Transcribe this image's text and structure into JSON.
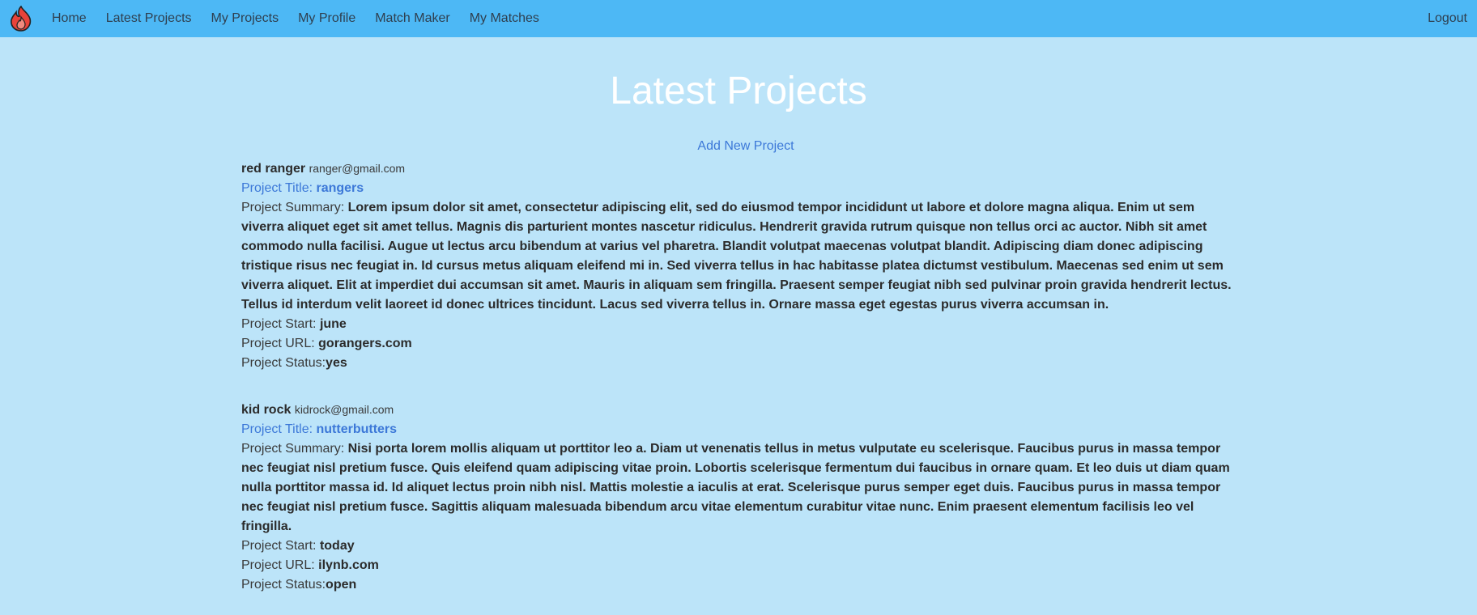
{
  "nav": {
    "links": [
      {
        "label": "Home"
      },
      {
        "label": "Latest Projects"
      },
      {
        "label": "My Projects"
      },
      {
        "label": "My Profile"
      },
      {
        "label": "Match Maker"
      },
      {
        "label": "My Matches"
      }
    ],
    "logout_label": "Logout",
    "logo_icon": "flame-icon"
  },
  "page": {
    "title": "Latest Projects",
    "add_project_label": "Add New Project"
  },
  "labels": {
    "project_title": "Project Title:",
    "project_summary": "Project Summary:",
    "project_start": "Project Start:",
    "project_url": "Project URL:",
    "project_status": "Project Status:"
  },
  "projects": [
    {
      "owner_name": "red ranger",
      "owner_email": "ranger@gmail.com",
      "title": "rangers",
      "summary": "Lorem ipsum dolor sit amet, consectetur adipiscing elit, sed do eiusmod tempor incididunt ut labore et dolore magna aliqua. Enim ut sem viverra aliquet eget sit amet tellus. Magnis dis parturient montes nascetur ridiculus. Hendrerit gravida rutrum quisque non tellus orci ac auctor. Nibh sit amet commodo nulla facilisi. Augue ut lectus arcu bibendum at varius vel pharetra. Blandit volutpat maecenas volutpat blandit. Adipiscing diam donec adipiscing tristique risus nec feugiat in. Id cursus metus aliquam eleifend mi in. Sed viverra tellus in hac habitasse platea dictumst vestibulum. Maecenas sed enim ut sem viverra aliquet. Elit at imperdiet dui accumsan sit amet. Mauris in aliquam sem fringilla. Praesent semper feugiat nibh sed pulvinar proin gravida hendrerit lectus. Tellus id interdum velit laoreet id donec ultrices tincidunt. Lacus sed viverra tellus in. Ornare massa eget egestas purus viverra accumsan in.",
      "start": "june",
      "url": "gorangers.com",
      "status": "yes"
    },
    {
      "owner_name": "kid rock",
      "owner_email": "kidrock@gmail.com",
      "title": "nutterbutters",
      "summary": "Nisi porta lorem mollis aliquam ut porttitor leo a. Diam ut venenatis tellus in metus vulputate eu scelerisque. Faucibus purus in massa tempor nec feugiat nisl pretium fusce. Quis eleifend quam adipiscing vitae proin. Lobortis scelerisque fermentum dui faucibus in ornare quam. Et leo duis ut diam quam nulla porttitor massa id. Id aliquet lectus proin nibh nisl. Mattis molestie a iaculis at erat. Scelerisque purus semper eget duis. Faucibus purus in massa tempor nec feugiat nisl pretium fusce. Sagittis aliquam malesuada bibendum arcu vitae elementum curabitur vitae nunc. Enim praesent elementum facilisis leo vel fringilla.",
      "start": "today",
      "url": "ilynb.com",
      "status": "open"
    }
  ],
  "colors": {
    "navbar_bg": "#4db8f5",
    "page_bg": "#bce4f9",
    "link_blue": "#3c78d8",
    "title_white": "#ffffff"
  }
}
